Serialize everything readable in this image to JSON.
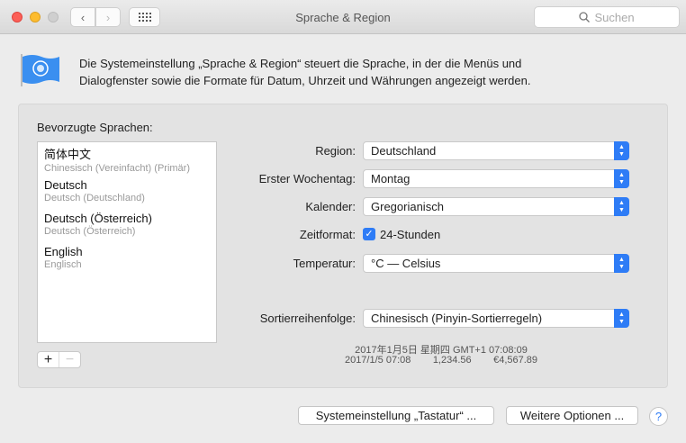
{
  "window": {
    "title": "Sprache & Region",
    "search_placeholder": "Suchen"
  },
  "intro": {
    "line1": "Die Systemeinstellung „Sprache & Region“ steuert die Sprache, in der die Menüs und",
    "line2": "Dialogfenster sowie die Formate für Datum, Uhrzeit und Währungen angezeigt werden."
  },
  "languages": {
    "label": "Bevorzugte Sprachen:",
    "items": [
      {
        "name": "简体中文",
        "sub": "Chinesisch (Vereinfacht) (Primär)"
      },
      {
        "name": "Deutsch",
        "sub": "Deutsch (Deutschland)"
      },
      {
        "name": "Deutsch (Österreich)",
        "sub": "Deutsch (Österreich)"
      },
      {
        "name": "English",
        "sub": "Englisch"
      }
    ],
    "add": "+",
    "remove": "−"
  },
  "settings": {
    "region": {
      "label": "Region:",
      "value": "Deutschland"
    },
    "weekday": {
      "label": "Erster Wochentag:",
      "value": "Montag"
    },
    "calendar": {
      "label": "Kalender:",
      "value": "Gregorianisch"
    },
    "timeformat": {
      "label": "Zeitformat:",
      "checkbox": "24-Stunden",
      "checked": true
    },
    "temperature": {
      "label": "Temperatur:",
      "value": "°C — Celsius"
    },
    "sort": {
      "label": "Sortierreihenfolge:",
      "value": "Chinesisch (Pinyin-Sortierregeln)"
    }
  },
  "formats": {
    "line1": "2017年1月5日 星期四 GMT+1 07:08:09",
    "date": "2017/1/5 07:08",
    "number": "1,234.56",
    "currency": "€4,567.89"
  },
  "buttons": {
    "keyboard": "Systemeinstellung „Tastatur“ ...",
    "advanced": "Weitere Optionen ...",
    "help": "?"
  }
}
